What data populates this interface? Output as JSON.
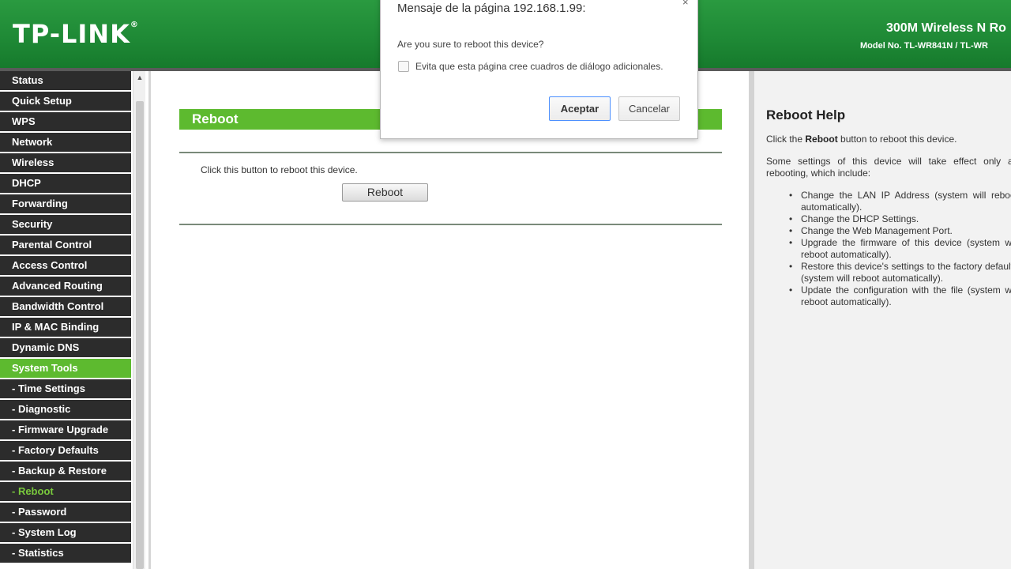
{
  "header": {
    "logo": "TP-LINK",
    "logo_reg": "®",
    "product": "300M Wireless N Ro",
    "model": "Model No. TL-WR841N / TL-WR"
  },
  "sidebar": {
    "items": [
      {
        "label": "Status"
      },
      {
        "label": "Quick Setup"
      },
      {
        "label": "WPS"
      },
      {
        "label": "Network"
      },
      {
        "label": "Wireless"
      },
      {
        "label": "DHCP"
      },
      {
        "label": "Forwarding"
      },
      {
        "label": "Security"
      },
      {
        "label": "Parental Control"
      },
      {
        "label": "Access Control"
      },
      {
        "label": "Advanced Routing"
      },
      {
        "label": "Bandwidth Control"
      },
      {
        "label": "IP & MAC Binding"
      },
      {
        "label": "Dynamic DNS"
      },
      {
        "label": "System Tools"
      },
      {
        "label": "- Time Settings"
      },
      {
        "label": "- Diagnostic"
      },
      {
        "label": "- Firmware Upgrade"
      },
      {
        "label": "- Factory Defaults"
      },
      {
        "label": "- Backup & Restore"
      },
      {
        "label": "- Reboot"
      },
      {
        "label": "- Password"
      },
      {
        "label": "- System Log"
      },
      {
        "label": "- Statistics"
      }
    ],
    "active_color": "#5dba2f",
    "item_color": "#2c2c2c"
  },
  "main": {
    "section_title": "Reboot",
    "instruction": "Click this button to reboot this device.",
    "reboot_button": "Reboot"
  },
  "help": {
    "title": "Reboot Help",
    "line1_pre": "Click the ",
    "line1_bold": "Reboot",
    "line1_post": " button to reboot this device.",
    "line2": "Some settings of this device will take effect only after rebooting, which include:",
    "bullets": [
      "Change the LAN IP Address (system will reboot automatically).",
      "Change the DHCP Settings.",
      "Change the Web Management Port.",
      "Upgrade the firmware of this device (system will reboot automatically).",
      "Restore this device's settings to the factory defaults (system will reboot automatically).",
      "Update the configuration with the file (system will reboot automatically)."
    ]
  },
  "dialog": {
    "title": "Mensaje de la página 192.168.1.99:",
    "close": "×",
    "message": "Are you sure to reboot this device?",
    "checkbox_label": "Evita que esta página cree cuadros de diálogo adicionales.",
    "accept": "Aceptar",
    "cancel": "Cancelar"
  },
  "colors": {
    "brand_green": "#1f8a36",
    "accent_green": "#5dba2f"
  }
}
